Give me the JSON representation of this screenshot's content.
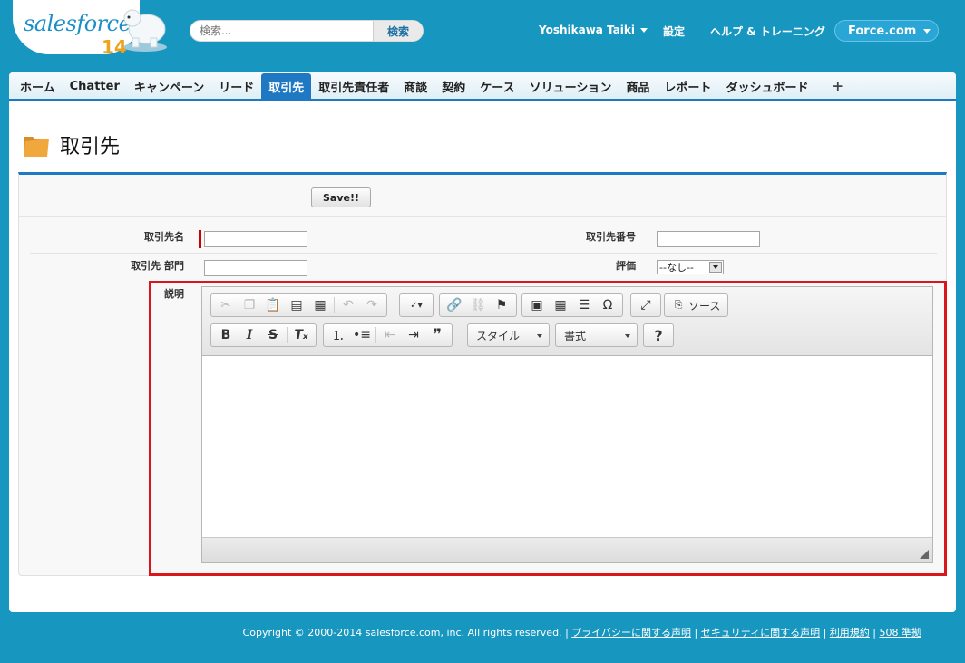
{
  "header": {
    "logo_text": "salesforce",
    "logo_version": "14",
    "search_placeholder": "検索...",
    "search_button": "検索",
    "user_name": "Yoshikawa Taiki",
    "links": [
      "設定",
      "ヘルプ & トレーニング"
    ],
    "app_menu": "Force.com"
  },
  "tabs": [
    {
      "label": "ホーム"
    },
    {
      "label": "Chatter"
    },
    {
      "label": "キャンペーン"
    },
    {
      "label": "リード"
    },
    {
      "label": "取引先"
    },
    {
      "label": "取引先責任者"
    },
    {
      "label": "商談"
    },
    {
      "label": "契約"
    },
    {
      "label": "ケース"
    },
    {
      "label": "ソリューション"
    },
    {
      "label": "商品"
    },
    {
      "label": "レポート"
    },
    {
      "label": "ダッシュボード"
    }
  ],
  "active_tab": "取引先",
  "add_tab": "+",
  "page": {
    "title": "取引先"
  },
  "form": {
    "save_button": "Save!!",
    "account_name_label": "取引先名",
    "account_number_label": "取引先番号",
    "account_dept_label": "取引先 部門",
    "rating_label": "評価",
    "rating_value": "--なし--",
    "description_label": "説明"
  },
  "editor": {
    "source_label": "ソース",
    "style_combo": "スタイル",
    "format_combo": "書式",
    "help_label": "?"
  },
  "footer": {
    "copyright": "Copyright © 2000-2014 salesforce.com, inc. All rights reserved.",
    "links": [
      "プライバシーに関する声明",
      "セキュリティに関する声明",
      "利用規約",
      "508 準拠"
    ]
  },
  "colors": {
    "brand_blue": "#1797c0",
    "tab_active": "#1e78c2",
    "highlight_red": "#d9161b"
  }
}
